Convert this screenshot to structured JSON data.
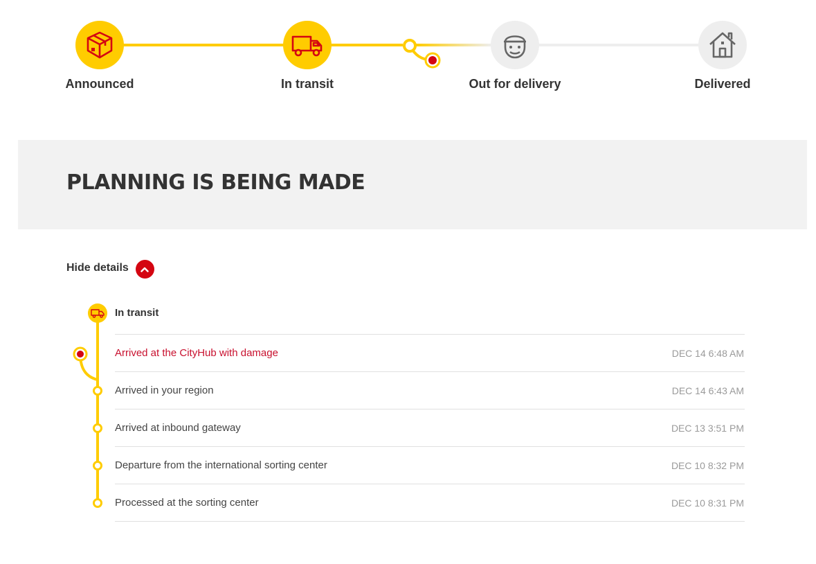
{
  "steps": [
    {
      "label": "Announced",
      "icon": "package-icon",
      "state": "done"
    },
    {
      "label": "In transit",
      "icon": "truck-icon",
      "state": "done"
    },
    {
      "label": "Out for delivery",
      "icon": "courier-icon",
      "state": "pending"
    },
    {
      "label": "Delivered",
      "icon": "house-icon",
      "state": "pending"
    }
  ],
  "status": {
    "title": "PLANNING IS BEING MADE"
  },
  "details": {
    "toggle_label": "Hide details"
  },
  "timeline": {
    "group_title": "In transit",
    "events": [
      {
        "text": "Arrived at the CityHub with damage",
        "time": "DEC 14 6:48 AM",
        "alert": true
      },
      {
        "text": "Arrived in your region",
        "time": "DEC 14 6:43 AM",
        "alert": false
      },
      {
        "text": "Arrived at inbound gateway",
        "time": "DEC 13 3:51 PM",
        "alert": false
      },
      {
        "text": "Departure from the international sorting center",
        "time": "DEC 10 8:32 PM",
        "alert": false
      },
      {
        "text": "Processed at the sorting center",
        "time": "DEC 10 8:31 PM",
        "alert": false
      }
    ]
  },
  "colors": {
    "yellow": "#ffcc00",
    "red": "#d40511",
    "grey": "#eeeeee",
    "icon_grey": "#666666"
  }
}
